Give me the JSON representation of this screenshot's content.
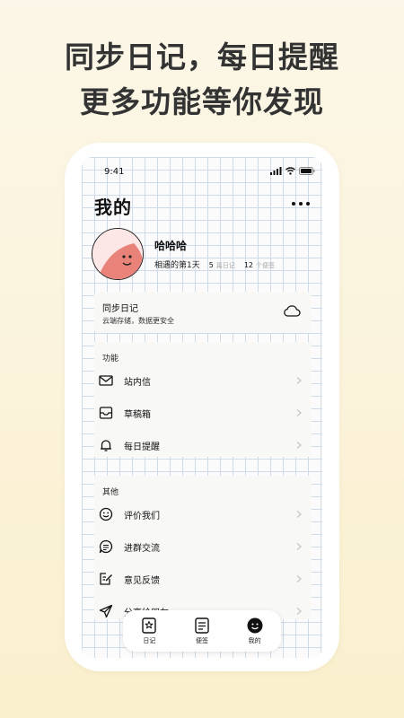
{
  "headline": {
    "line1": "同步日记，每日提醒",
    "line2": "更多功能等你发现"
  },
  "status_bar": {
    "time": "9:41"
  },
  "page": {
    "title": "我的"
  },
  "profile": {
    "nickname": "哈哈哈",
    "meet_text": "相遇的第1天",
    "diary_count": "5",
    "diary_unit": "篇日记",
    "note_count": "12",
    "note_unit": "个便签"
  },
  "sync": {
    "title": "同步日记",
    "subtitle": "云端存储，数据更安全",
    "icon": "cloud-icon"
  },
  "features": {
    "label": "功能",
    "items": [
      {
        "label": "站内信",
        "icon": "mail-icon"
      },
      {
        "label": "草稿箱",
        "icon": "inbox-icon"
      },
      {
        "label": "每日提醒",
        "icon": "bell-icon"
      }
    ]
  },
  "others": {
    "label": "其他",
    "items": [
      {
        "label": "评价我们",
        "icon": "smile-icon"
      },
      {
        "label": "进群交流",
        "icon": "chat-icon"
      },
      {
        "label": "意见反馈",
        "icon": "edit-icon"
      },
      {
        "label": "分享给朋友",
        "icon": "send-icon"
      }
    ]
  },
  "tabs": [
    {
      "label": "日记",
      "icon": "star-book-icon"
    },
    {
      "label": "便签",
      "icon": "note-icon"
    },
    {
      "label": "我的",
      "icon": "face-icon"
    }
  ],
  "colors": {
    "avatar_bg": "#fde6e6",
    "avatar_face": "#e9837a",
    "grid": "#cfdbe8",
    "background": "#fbf3da"
  }
}
